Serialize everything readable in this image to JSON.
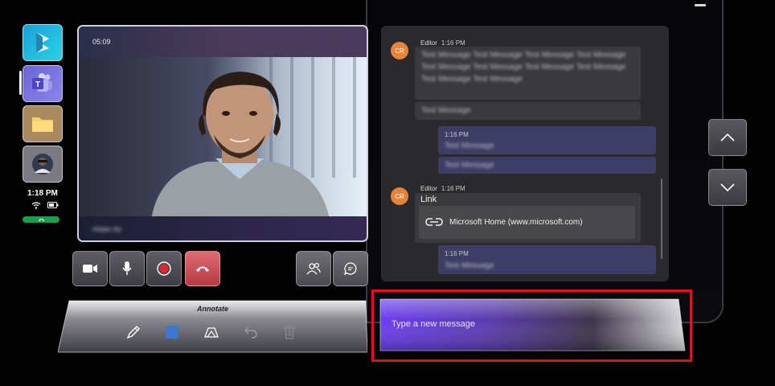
{
  "app": {
    "status_time": "1:18 PM"
  },
  "video": {
    "timer": "05:09",
    "participant_name": "Hidan As"
  },
  "call_controls": {
    "camera": "camera-icon",
    "microphone": "microphone-icon",
    "record": "record-icon",
    "end_call": "hang-up-icon",
    "people": "people-icon",
    "chat": "chat-icon"
  },
  "annotate": {
    "title": "Annotate",
    "tools": [
      "pen-icon",
      "color-swatch-icon",
      "shapes-icon",
      "undo-icon",
      "delete-icon"
    ],
    "swatch_color": "#3a78d4"
  },
  "chat": {
    "messages": [
      {
        "avatar": "CR",
        "sender": "Editor",
        "time": "1:16 PM",
        "text": "Test Message Test Message Test Message Test Message Test Message Test Message Test Message Test Message Test Message Test Message",
        "followup": "Test Message"
      },
      {
        "self": true,
        "time": "1:16 PM",
        "text": "Test Message",
        "followup": "Test Message"
      },
      {
        "avatar": "CR",
        "sender": "Editor",
        "time": "1:16 PM",
        "text": "Link",
        "link_card": "Microsoft Home (www.microsoft.com)"
      },
      {
        "self": true,
        "time": "1:16 PM",
        "text": "Test Message"
      }
    ]
  },
  "compose": {
    "placeholder": "Type a new message"
  },
  "colors": {
    "teams_accent": "#6b64d8",
    "avatar_bg": "#e8833a",
    "end_call": "#c8444e",
    "highlight": "#e0121e"
  }
}
